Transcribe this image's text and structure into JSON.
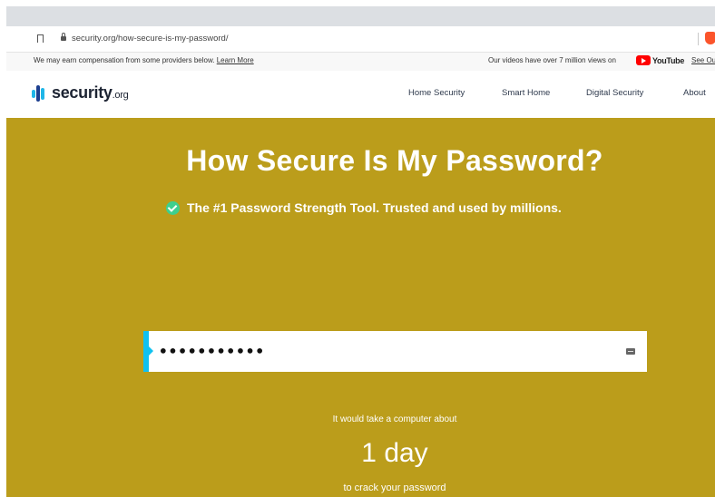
{
  "browser": {
    "url": "security.org/how-secure-is-my-password/"
  },
  "notice": {
    "text": "We may earn compensation from some providers below.",
    "learn_more": "Learn More",
    "videos_text": "Our videos have over 7 million views on",
    "youtube_label": "YouTube",
    "see_our": "See Ou"
  },
  "logo": {
    "name": "security",
    "suffix": ".org"
  },
  "nav": {
    "items": [
      "Home Security",
      "Smart Home",
      "Digital Security",
      "About"
    ]
  },
  "hero": {
    "title": "How Secure Is My Password?",
    "subtitle": "The #1 Password Strength Tool. Trusted and used by millions.",
    "password_value": "•••••••••••",
    "result_pre": "It would take a computer about",
    "result_time": "1 day",
    "result_post": "to crack your password"
  },
  "colors": {
    "hero_bg": "#bb9d1b",
    "accent": "#10c1f0",
    "check": "#3ecf8e"
  }
}
